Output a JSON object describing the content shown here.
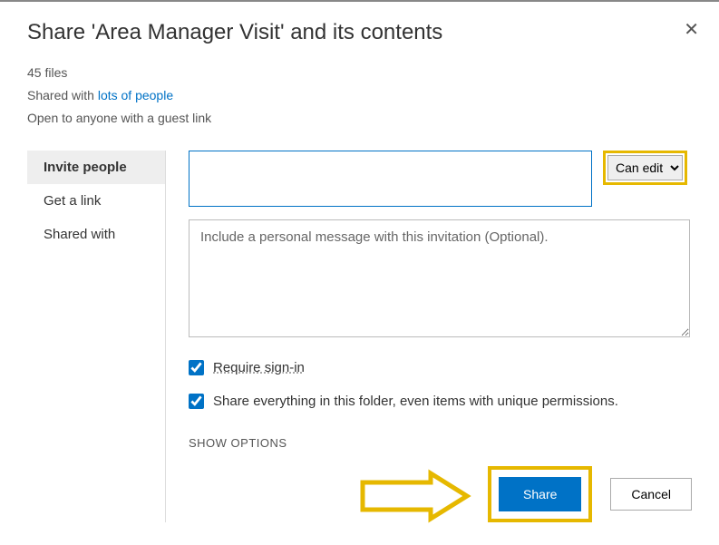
{
  "dialog": {
    "title": "Share 'Area Manager Visit' and its contents",
    "fileCount": "45 files",
    "sharedWithPrefix": "Shared with ",
    "sharedWithLink": "lots of people",
    "guestLinkText": "Open to anyone with a guest link"
  },
  "sidebar": {
    "items": [
      {
        "label": "Invite people"
      },
      {
        "label": "Get a link"
      },
      {
        "label": "Shared with"
      }
    ]
  },
  "content": {
    "permissionSelected": "Can edit",
    "messagePlaceholder": "Include a personal message with this invitation (Optional).",
    "requireSignIn": "Require sign-in",
    "shareEverything": "Share everything in this folder, even items with unique permissions.",
    "showOptions": "SHOW OPTIONS",
    "shareBtn": "Share",
    "cancelBtn": "Cancel"
  }
}
